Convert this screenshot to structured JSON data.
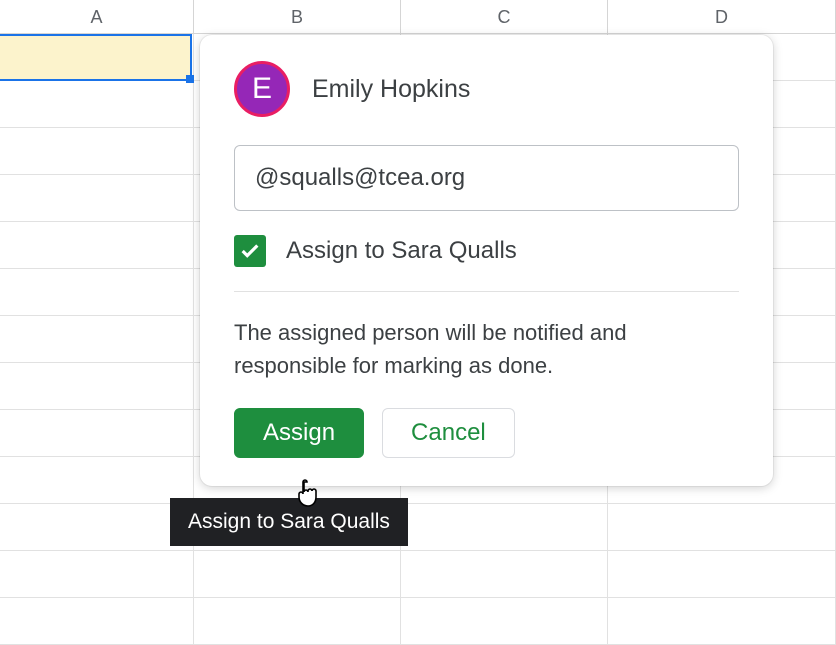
{
  "columns": {
    "A": "A",
    "B": "B",
    "C": "C",
    "D": "D"
  },
  "commentDialog": {
    "authorInitial": "E",
    "authorName": "Emily Hopkins",
    "commentValue": "@squalls@tcea.org",
    "assignCheckbox": {
      "checked": true,
      "label": "Assign to Sara Qualls"
    },
    "helperText": "The assigned person will be notified and responsible for marking as done.",
    "assignButton": "Assign",
    "cancelButton": "Cancel"
  },
  "tooltip": "Assign to Sara Qualls"
}
